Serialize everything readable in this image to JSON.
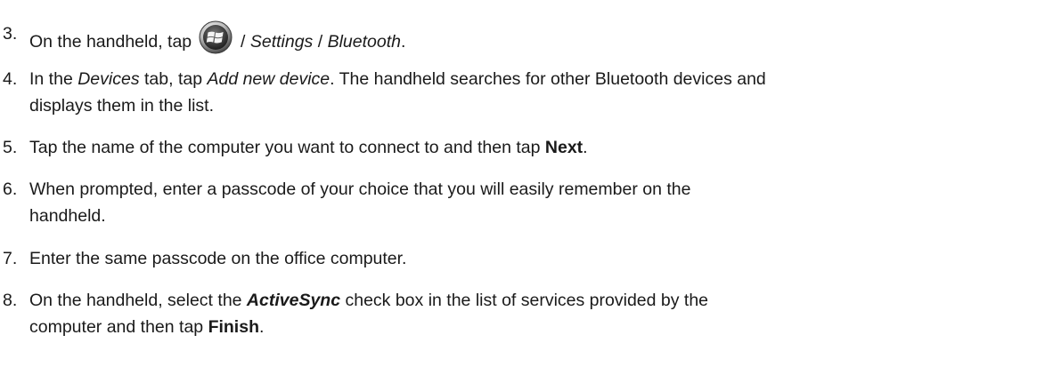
{
  "steps": [
    {
      "number": "3.",
      "prefix": "On the handheld, tap",
      "sep1": " / ",
      "settings": "Settings",
      "sep2": " / ",
      "bluetooth": "Bluetooth",
      "end": "."
    },
    {
      "number": "4.",
      "pre": "In the ",
      "devices": "Devices",
      "mid": " tab, tap ",
      "add_new_device": "Add new device",
      "post": ". The handheld searches for other Bluetooth devices and",
      "line2": "displays them in the list."
    },
    {
      "number": "5.",
      "pre": "Tap the name of the computer you want to connect to and then tap ",
      "next": "Next",
      "end": "."
    },
    {
      "number": "6.",
      "line1": "When prompted, enter a passcode of your choice that you will easily remember on the",
      "line2": "handheld."
    },
    {
      "number": "7.",
      "text": "Enter the same passcode on the office computer."
    },
    {
      "number": "8.",
      "pre": "On the handheld, select the ",
      "activesync": "ActiveSync",
      "post": " check box in the list of services provided by the",
      "line2_pre": "computer and then tap ",
      "finish": "Finish",
      "end": "."
    }
  ],
  "start_icon": "windows-start-icon"
}
